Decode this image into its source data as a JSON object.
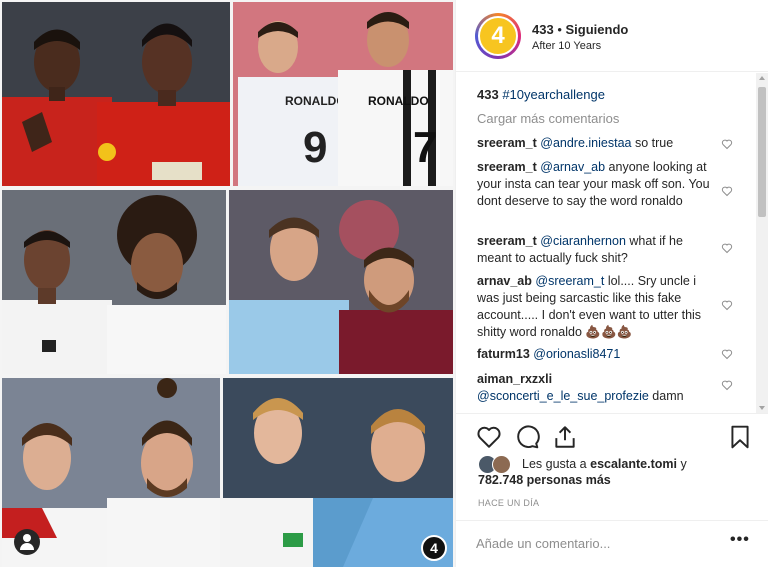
{
  "post": {
    "username": "433",
    "follow_status": "Siguiendo",
    "separator": "•",
    "location": "After 10 Years",
    "avatar_text": "4",
    "watermark_text": "4",
    "caption_user": "433",
    "caption_hashtag": "#10yearchallenge",
    "load_more": "Cargar más comentarios",
    "comments": [
      {
        "user": "sreeram_t",
        "mention": "@andre.iniestaa",
        "text": " so true"
      },
      {
        "user": "sreeram_t",
        "mention": "@arnav_ab",
        "text": " anyone looking at your insta can tear your mask off son. You dont deserve to say the word ronaldo"
      },
      {
        "user": "sreeram_t",
        "mention": "@ciaranhernon",
        "text": " what if he meant to actually fuck shit?"
      },
      {
        "user": "arnav_ab",
        "mention": "@sreeram_t",
        "text": " lol.... Sry uncle i was just being sarcastic like this fake account..... I don't even want to utter this shitty word ronaldo 💩💩💩"
      },
      {
        "user": "faturm13",
        "mention": "@orionasli8471",
        "text": ""
      },
      {
        "user": "aiman_rxzxli",
        "mention": "@sconcerti_e_le_sue_profezie",
        "text": " damn"
      }
    ],
    "likes_prefix": "Les gusta a",
    "likes_user": "escalante.tomi",
    "likes_conj": "y",
    "likes_count": "782.748 personas más",
    "timestamp": "HACE UN DÍA",
    "comment_placeholder": "Añade un comentario...",
    "more_options": "•••",
    "jersey_1": "RONALDO",
    "jersey_1_number": "9",
    "jersey_2": "RONALDO",
    "jersey_2_number": "7"
  },
  "colors": {
    "accent_link": "#003569",
    "muted": "#8e8e8e",
    "avatar_bg": "#f7c520",
    "united_red": "#d9241b",
    "city_blue": "#6cabdd"
  },
  "icons": [
    "heart-icon",
    "comment-icon",
    "share-icon",
    "bookmark-icon",
    "user-tag-icon"
  ]
}
